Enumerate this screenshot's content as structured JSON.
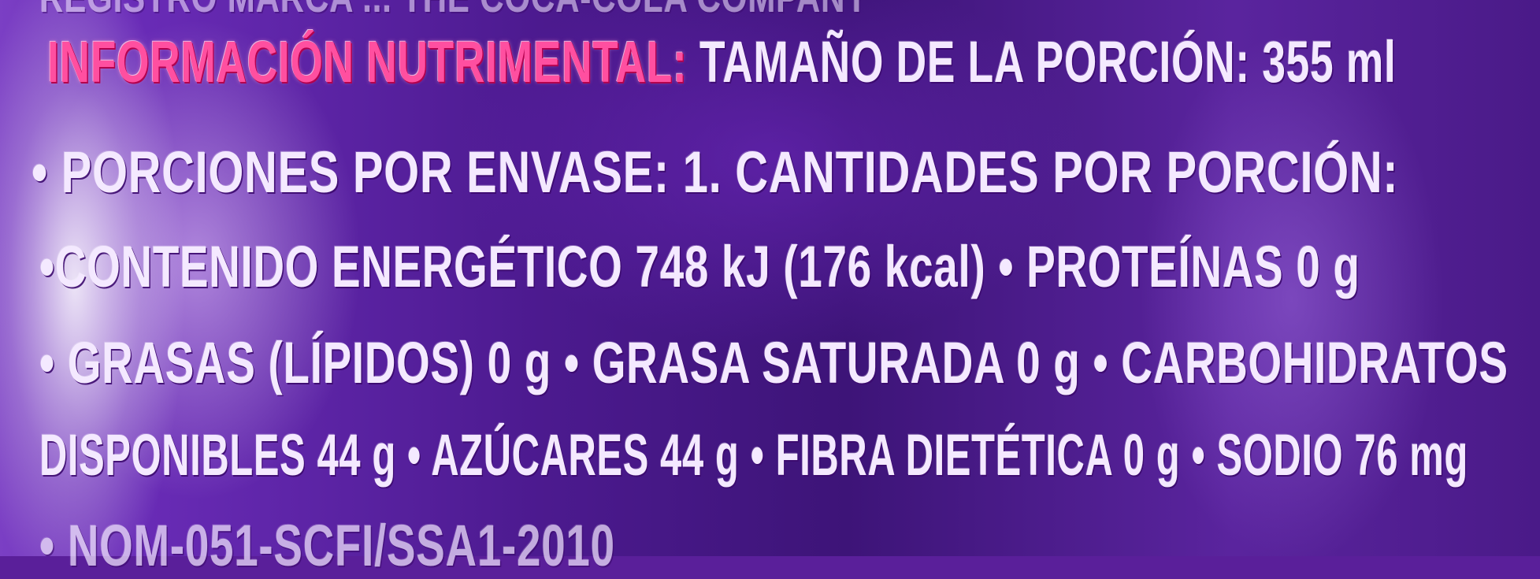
{
  "label": {
    "line0": "REGISTRO MARCA ... THE COCA-COLA COMPANY",
    "title": "INFORMACIÓN NUTRIMENTAL:",
    "line1_rest": " TAMAÑO DE LA PORCIÓN: 355 ml",
    "line2": "• PORCIONES POR ENVASE: 1. CANTIDADES POR PORCIÓN:",
    "line3": "•CONTENIDO ENERGÉTICO 748 kJ (176 kcal) • PROTEÍNAS 0 g",
    "line4": "• GRASAS (LÍPIDOS) 0 g • GRASA SATURADA 0 g • CARBOHIDRATOS",
    "line5": "DISPONIBLES 44 g • AZÚCARES 44 g • FIBRA DIETÉTICA 0 g • SODIO 76 mg",
    "line6": "• NOM-051-SCFI/SSA1-2010"
  },
  "colors": {
    "background": "#4c1a8f",
    "text": "#f4e9ff",
    "title": "#ff4fa0"
  }
}
